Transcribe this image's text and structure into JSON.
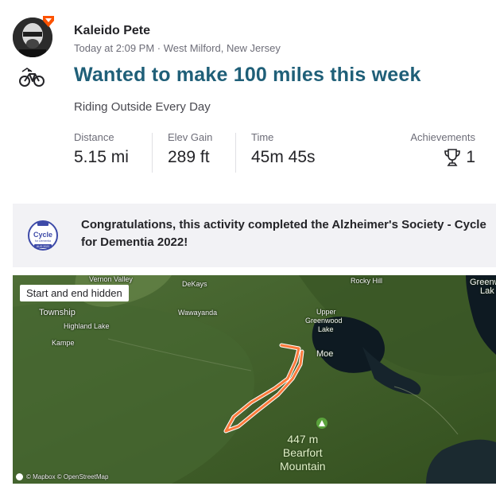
{
  "athlete": {
    "name": "Kaleido Pete",
    "meta": "Today at 2:09 PM · West Milford, New Jersey"
  },
  "activity": {
    "title": "Wanted to make 100 miles this week",
    "description": "Riding Outside Every Day",
    "type_icon": "bike-icon"
  },
  "stats": {
    "distance": {
      "label": "Distance",
      "value": "5.15 mi"
    },
    "elev_gain": {
      "label": "Elev Gain",
      "value": "289 ft"
    },
    "time": {
      "label": "Time",
      "value": "45m 45s"
    },
    "achievements": {
      "label": "Achievements",
      "value": "1",
      "icon": "trophy-icon"
    }
  },
  "challenge": {
    "text": "Congratulations, this activity completed the Alzheimer's Society - Cycle for Dementia 2022!",
    "badge_title": "Cycle",
    "badge_sub": "for Dementia",
    "badge_date": "AUG 2022"
  },
  "map": {
    "hidden_notice": "Start and end hidden",
    "labels": {
      "vernon_valley": "Vernon Valley",
      "dekays": "DeKays",
      "rocky_hill": "Rocky Hill",
      "greenwood_lake_edge": "Greenw",
      "lake_edge": "Lak",
      "township": "Township",
      "highland_lake": "Highland Lake",
      "kampe": "Kampe",
      "wawayanda": "Wawayanda",
      "upper": "Upper",
      "greenwood": "Greenwood",
      "lake": "Lake",
      "moe": "Moe"
    },
    "peak": {
      "elevation": "447 m",
      "name_line1": "Bearfort",
      "name_line2": "Mountain"
    },
    "attribution": "© Mapbox © OpenStreetMap"
  },
  "colors": {
    "title": "#1f5f78",
    "route": "#fc7a3c",
    "challenge_bg": "#f2f2f5",
    "map_green": "#3f5d2c",
    "water": "#0e1a22"
  }
}
